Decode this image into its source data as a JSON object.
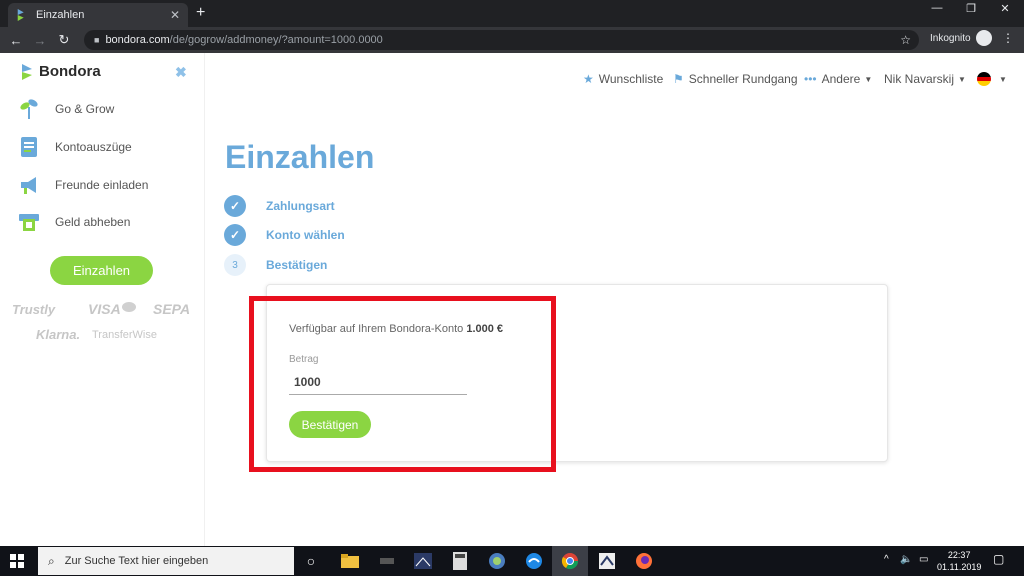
{
  "browser": {
    "tab_title": "Einzahlen",
    "tab_close": "✕",
    "new_tab": "+",
    "url_host": "bondora.com",
    "url_path": "/de/gogrow/addmoney/?amount=1000.0000",
    "incognito_label": "Inkognito",
    "window_min": "—",
    "window_restore": "❐",
    "window_close": "✕"
  },
  "sidebar": {
    "brand": "Bondora",
    "close": "✖",
    "items": [
      {
        "label": "Go & Grow",
        "icon": "sprout-icon"
      },
      {
        "label": "Kontoauszüge",
        "icon": "document-icon"
      },
      {
        "label": "Freunde einladen",
        "icon": "megaphone-icon"
      },
      {
        "label": "Geld abheben",
        "icon": "atm-icon"
      }
    ],
    "deposit_button": "Einzahlen",
    "payment_logos": [
      "Trustly",
      "VISA",
      "SEPA",
      "Klarna.",
      "TransferWise"
    ]
  },
  "topnav": {
    "wishlist": "Wunschliste",
    "tour": "Schneller Rundgang",
    "more": "Andere",
    "user": "Nik Navarskij"
  },
  "main": {
    "title": "Einzahlen",
    "steps": [
      {
        "label": "Zahlungsart",
        "state": "done",
        "marker": "✓"
      },
      {
        "label": "Konto wählen",
        "state": "done",
        "marker": "✓"
      },
      {
        "label": "Bestätigen",
        "state": "current",
        "marker": "3"
      }
    ],
    "available_text": "Verfügbar auf Ihrem Bondora-Konto",
    "available_amount": "1.000 €",
    "amount_label": "Betrag",
    "amount_value": "1000",
    "confirm_button": "Bestätigen"
  },
  "taskbar": {
    "search_placeholder": "Zur Suche Text hier eingeben",
    "time": "22:37",
    "date": "01.11.2019"
  },
  "colors": {
    "accent_blue": "#6aa9da",
    "accent_green": "#8bd542",
    "highlight_red": "#e8101e"
  }
}
